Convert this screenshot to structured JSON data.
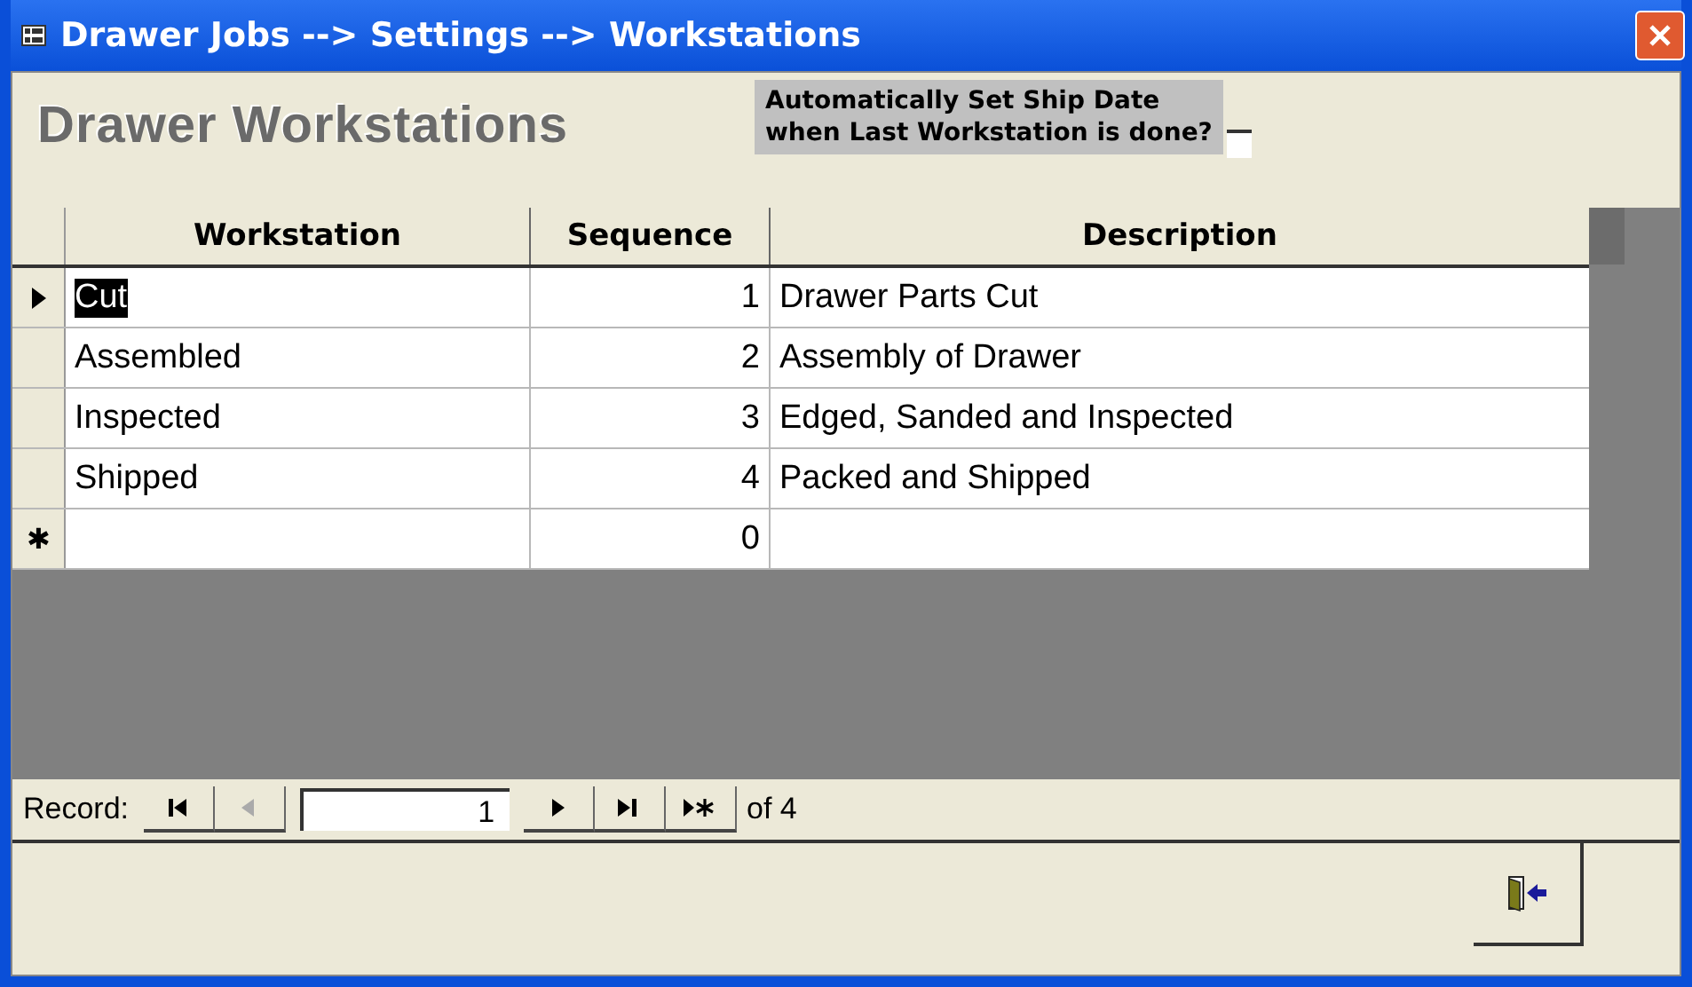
{
  "window": {
    "title": "Drawer Jobs --> Settings --> Workstations"
  },
  "form_title": "Drawer Workstations",
  "auto_ship": {
    "label_line_1": "Automatically Set Ship Date",
    "label_line_2": "when Last Workstation is done?",
    "checked": false
  },
  "table": {
    "columns": [
      "Workstation",
      "Sequence",
      "Description"
    ],
    "rows": [
      {
        "kind": "record",
        "selected": true,
        "cells": [
          "Cut",
          "1",
          "Drawer Parts Cut"
        ]
      },
      {
        "kind": "record",
        "selected": false,
        "cells": [
          "Assembled",
          "2",
          "Assembly of Drawer"
        ]
      },
      {
        "kind": "record",
        "selected": false,
        "cells": [
          "Inspected",
          "3",
          "Edged, Sanded and Inspected"
        ]
      },
      {
        "kind": "record",
        "selected": false,
        "cells": [
          "Shipped",
          "4",
          "Packed and Shipped"
        ]
      },
      {
        "kind": "new",
        "selected": false,
        "marker": "✱",
        "cells": [
          "",
          "0",
          ""
        ]
      }
    ]
  },
  "navigation": {
    "label": "Record:",
    "value": "1",
    "total": "of 4",
    "buttons": [
      {
        "kind": "first",
        "disabled": false
      },
      {
        "kind": "prev",
        "disabled": true
      },
      {
        "kind": "next",
        "disabled": false
      },
      {
        "kind": "last",
        "disabled": false
      },
      {
        "kind": "new",
        "disabled": false
      }
    ]
  }
}
